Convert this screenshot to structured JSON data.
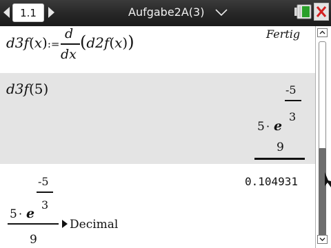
{
  "header": {
    "tab_label": "1.1",
    "doc_title": "Aufgabe2A(3)"
  },
  "history": [
    {
      "input": {
        "lhs_name": "d3f",
        "lhs_arg": "x",
        "assign": ":=",
        "deriv_num": "d",
        "deriv_den": "dx",
        "inner_name": "d2f",
        "inner_arg": "x"
      },
      "result": "Fertig"
    },
    {
      "input": {
        "name": "d3f",
        "arg": "5"
      },
      "result": {
        "coefficient": "5",
        "dot": "·",
        "base": "e",
        "exp_num": "-5",
        "exp_den": "3",
        "denominator": "9"
      }
    },
    {
      "input": {
        "coefficient": "5",
        "dot": "·",
        "base": "e",
        "exp_num": "-5",
        "exp_den": "3",
        "denominator": "9",
        "command": "Decimal"
      },
      "result": "0.104931"
    }
  ],
  "colors": {
    "topbar": "#262626",
    "selected_row": "#e4e4e4",
    "close_red": "#d32020",
    "battery_green": "#2aa02a"
  }
}
